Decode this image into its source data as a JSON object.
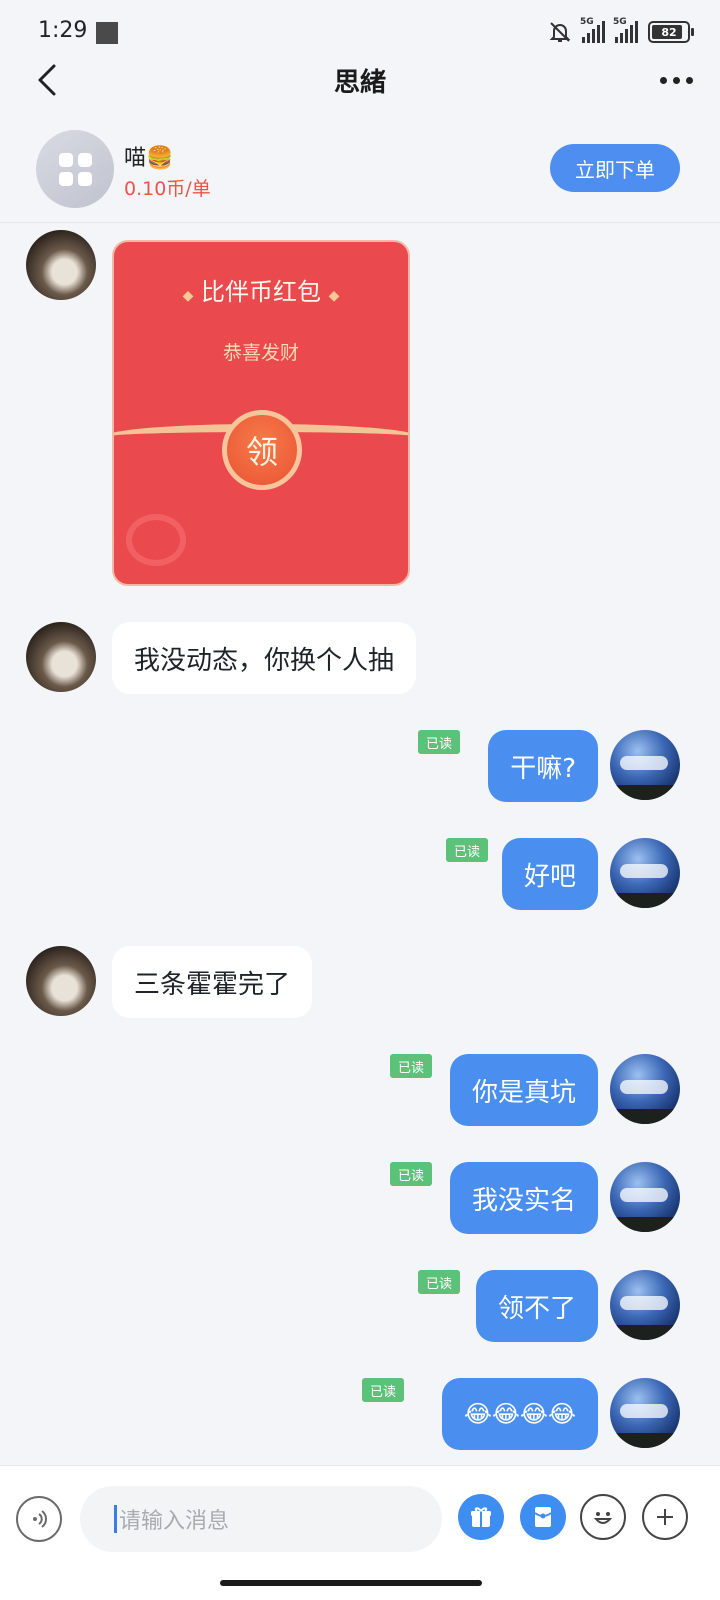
{
  "status_bar": {
    "time": "1:29",
    "battery": "82",
    "sim1": "5G",
    "sim2": "5G"
  },
  "nav": {
    "title": "思緒"
  },
  "service": {
    "name": "喵🍔",
    "price": "0.10币/单",
    "order_label": "立即下单"
  },
  "red_packet": {
    "title": "比伴币红包",
    "greeting": "恭喜发财",
    "claim_label": "领"
  },
  "messages": [
    {
      "side": "left",
      "text": "我没动态，你换个人抽"
    },
    {
      "side": "right",
      "text": "干嘛?",
      "read": "已读"
    },
    {
      "side": "right",
      "text": "好吧",
      "read": "已读"
    },
    {
      "side": "left",
      "text": "三条霍霍完了"
    },
    {
      "side": "right",
      "text": "你是真坑",
      "read": "已读"
    },
    {
      "side": "right",
      "text": "我没实名",
      "read": "已读"
    },
    {
      "side": "right",
      "text": "领不了",
      "read": "已读"
    },
    {
      "side": "right",
      "text": "😂😂😂😂",
      "read": "已读"
    }
  ],
  "input": {
    "placeholder": "请输入消息"
  },
  "colors": {
    "accent": "#4a8ff0",
    "red_packet": "#ea4a4d",
    "read_badge": "#5cc27a",
    "price": "#e8564a"
  }
}
